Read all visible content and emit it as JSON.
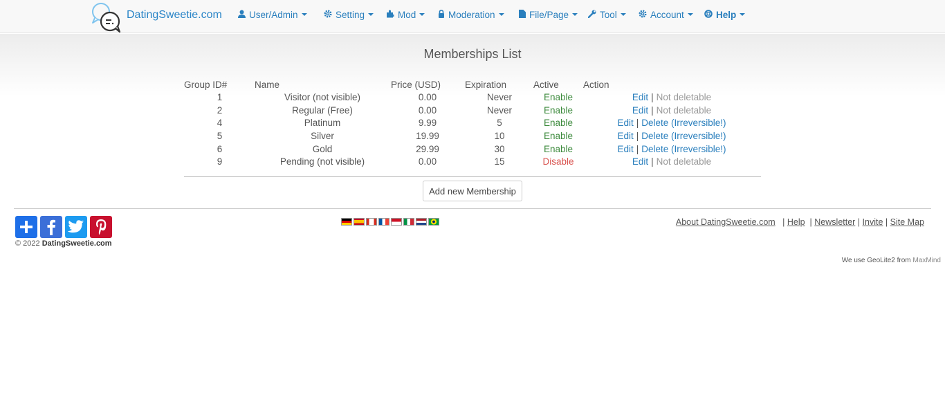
{
  "brand": {
    "name": "DatingSweetie.com"
  },
  "nav": [
    {
      "label": "User/Admin",
      "icon": "user-icon"
    },
    {
      "label": "Setting",
      "icon": "gear-icon"
    },
    {
      "label": "Mod",
      "icon": "puzzle-icon"
    },
    {
      "label": "Moderation",
      "icon": "lock-icon"
    },
    {
      "label": "File/Page",
      "icon": "file-icon"
    },
    {
      "label": "Tool",
      "icon": "wrench-icon"
    },
    {
      "label": "Account",
      "icon": "gear-icon"
    },
    {
      "label": "Help",
      "icon": "lifebuoy-icon"
    }
  ],
  "page": {
    "title": "Memberships List"
  },
  "table": {
    "headers": [
      "Group ID#",
      "Name",
      "Price (USD)",
      "Expiration",
      "Active",
      "Action"
    ],
    "rows": [
      {
        "id": "1",
        "name": "Visitor (not visible)",
        "price": "0.00",
        "expiration": "Never",
        "active": "Enable",
        "edit": "Edit",
        "sep": "|",
        "action2": "Not deletable"
      },
      {
        "id": "2",
        "name": "Regular (Free)",
        "price": "0.00",
        "expiration": "Never",
        "active": "Enable",
        "edit": "Edit",
        "sep": "|",
        "action2": "Not deletable"
      },
      {
        "id": "4",
        "name": "Platinum",
        "price": "9.99",
        "expiration": "5",
        "active": "Enable",
        "edit": "Edit",
        "sep": "|",
        "action2": "Delete (Irreversible!)"
      },
      {
        "id": "5",
        "name": "Silver",
        "price": "19.99",
        "expiration": "10",
        "active": "Enable",
        "edit": "Edit",
        "sep": "|",
        "action2": "Delete (Irreversible!)"
      },
      {
        "id": "6",
        "name": "Gold",
        "price": "29.99",
        "expiration": "30",
        "active": "Enable",
        "edit": "Edit",
        "sep": "|",
        "action2": "Delete (Irreversible!)"
      },
      {
        "id": "9",
        "name": "Pending (not visible)",
        "price": "0.00",
        "expiration": "15",
        "active": "Disable",
        "edit": "Edit",
        "sep": "|",
        "action2": "Not deletable"
      }
    ]
  },
  "add_button": {
    "label": "Add new Membership"
  },
  "footer": {
    "share_icons": [
      "addthis-plus-icon",
      "facebook-icon",
      "twitter-icon",
      "pinterest-icon"
    ],
    "copyright_prefix": "© 2022",
    "copyright_name": "DatingSweetie.com",
    "flags": [
      "flag-germany-icon",
      "flag-spain-icon",
      "flag-canada-icon",
      "flag-france-icon",
      "flag-indonesia-icon",
      "flag-italy-icon",
      "flag-netherlands-icon",
      "flag-brazil-icon"
    ],
    "links": [
      "About DatingSweetie.com",
      "Help",
      "Newsletter",
      "Invite",
      "Site Map"
    ],
    "link_sep": "|",
    "geo_text": "We use GeoLite2 from",
    "geo_link": "MaxMind"
  },
  "colors": {
    "link": "#2a7fbd",
    "enable": "#3c8a3c",
    "disable": "#d9534f"
  }
}
